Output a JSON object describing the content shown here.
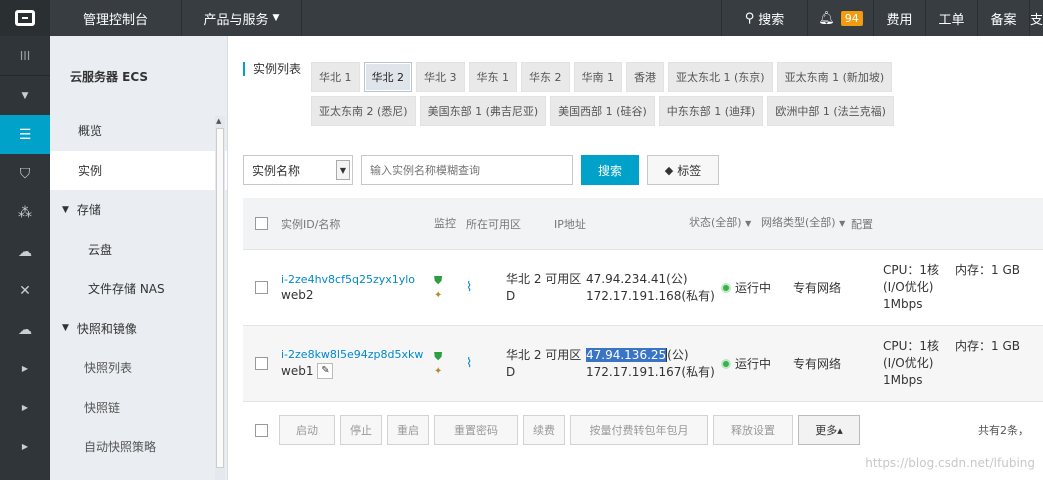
{
  "topbar": {
    "home": "管理控制台",
    "products": "产品与服务",
    "search": "搜索",
    "notifications": "94",
    "cost": "费用",
    "ticket": "工单",
    "icp": "备案",
    "more": "支"
  },
  "sidebar": {
    "title": "云服务器 ECS",
    "items": [
      "概览",
      "实例"
    ],
    "storage_group": "存储",
    "storage_items": [
      "云盘",
      "文件存储 NAS"
    ],
    "snapshot_group": "快照和镜像",
    "snapshot_items": [
      "快照列表",
      "快照链",
      "自动快照策略"
    ]
  },
  "region": {
    "label": "实例列表",
    "items": [
      "华北 1",
      "华北 2",
      "华北 3",
      "华东 1",
      "华东 2",
      "华南 1",
      "香港",
      "亚太东北 1 (东京)",
      "亚太东南 1 (新加坡)",
      "亚太东南 2 (悉尼)",
      "美国东部 1 (弗吉尼亚)",
      "美国西部 1 (硅谷)",
      "中东东部 1 (迪拜)",
      "欧洲中部 1 (法兰克福)"
    ],
    "active": "华北 2"
  },
  "filter": {
    "select": "实例名称",
    "placeholder": "输入实例名称模糊查询",
    "search_btn": "搜索",
    "tag_btn": "标签"
  },
  "table": {
    "headers": {
      "id": "实例ID/名称",
      "monitor": "监控",
      "zone": "所在可用区",
      "ip": "IP地址",
      "status": "状态(全部)",
      "net": "网络类型(全部)",
      "config": "配置"
    },
    "rows": [
      {
        "id": "i-2ze4hv8cf5q25zyx1ylo",
        "name": "web2",
        "zone": "华北 2 可用区 D",
        "ip_pub": "47.94.234.41(公)",
        "ip_priv": "172.17.191.168(私有)",
        "status": "运行中",
        "net": "专有网络",
        "cpu": "CPU：1核 (I/O优化) 1Mbps",
        "mem": "内存：1 GB"
      },
      {
        "id": "i-2ze8kw8l5e94zp8d5xkw",
        "name": "web1",
        "zone": "华北 2 可用区 D",
        "ip_pub_selected": "47.94.136.25",
        "ip_pub_rest": "(公)",
        "ip_priv": "172.17.191.167(私有)",
        "status": "运行中",
        "net": "专有网络",
        "cpu": "CPU：1核 (I/O优化) 1Mbps",
        "mem": "内存：1 GB"
      }
    ]
  },
  "footer": {
    "buttons": [
      "启动",
      "停止",
      "重启",
      "重置密码",
      "续费",
      "按量付费转包年包月",
      "释放设置",
      "更多▴"
    ],
    "count": "共有2条，"
  },
  "watermark": "https://blog.csdn.net/lfubing"
}
